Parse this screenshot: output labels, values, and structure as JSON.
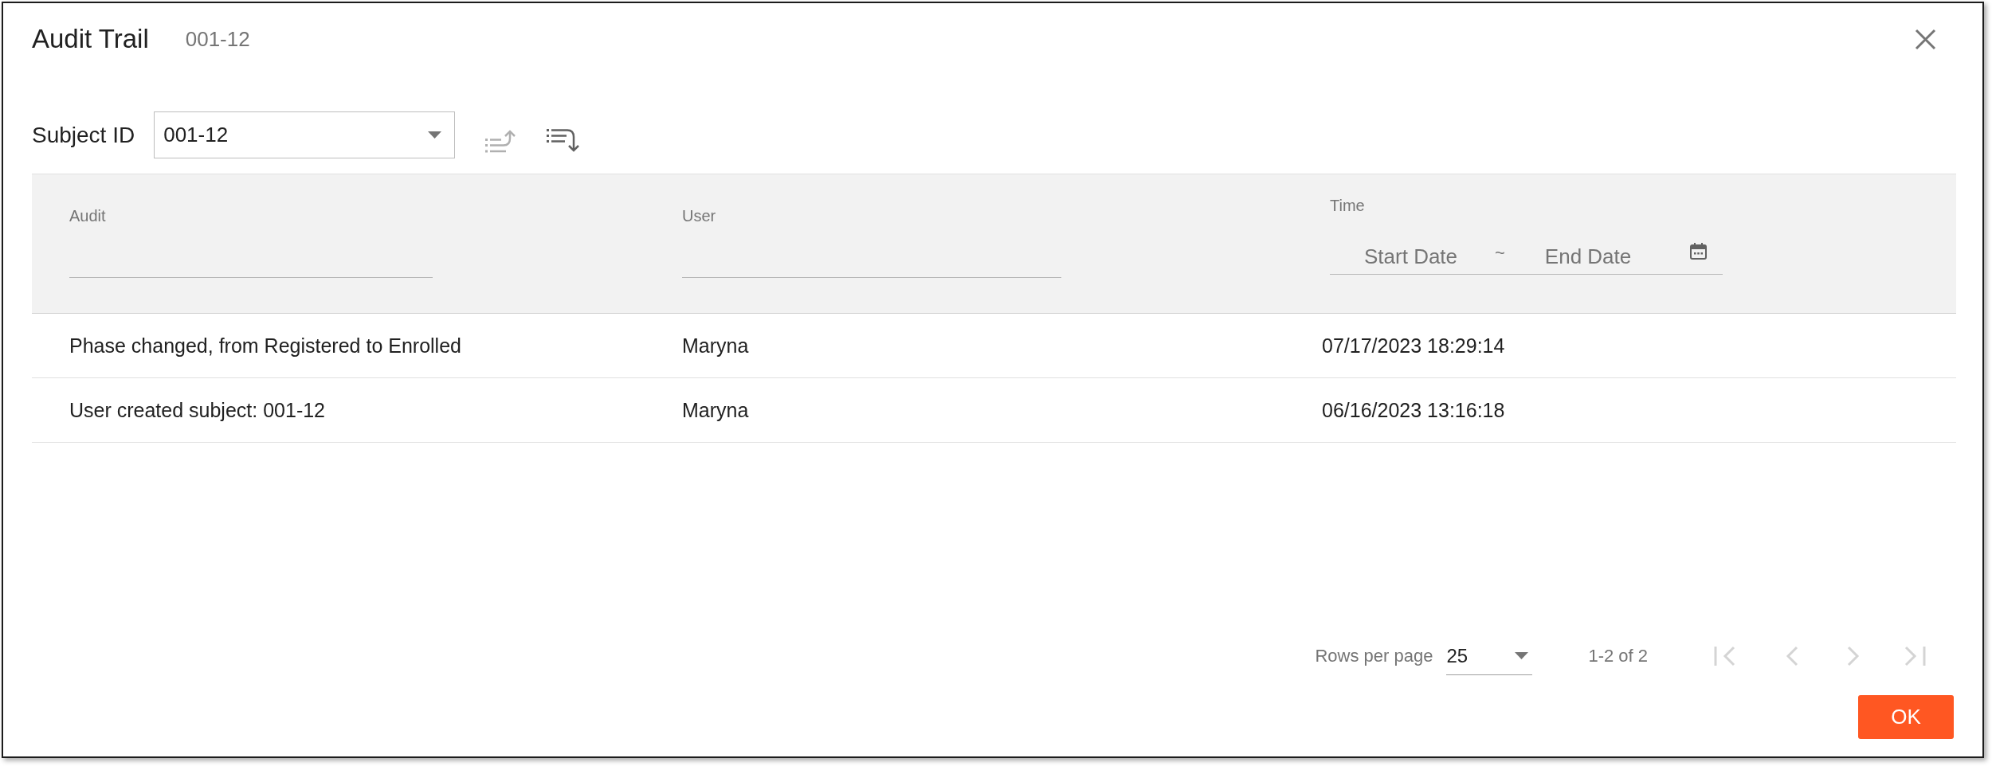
{
  "dialog": {
    "title": "Audit Trail",
    "subtitle": "001-12"
  },
  "toolbar": {
    "label": "Subject ID",
    "select_value": "001-12",
    "sort_buttons": [
      {
        "kind": "ascending",
        "disabled": true
      },
      {
        "kind": "descending",
        "disabled": false
      }
    ]
  },
  "table": {
    "columns": [
      {
        "label": "Audit",
        "kind": "text_filter"
      },
      {
        "label": "User",
        "kind": "text_filter"
      },
      {
        "label": "Time",
        "kind": "date_range",
        "start_placeholder": "Start Date",
        "separator": "~",
        "end_placeholder": "End Date"
      }
    ],
    "rows": [
      [
        "Phase changed, from Registered to Enrolled",
        "Maryna",
        "07/17/2023 18:29:14"
      ],
      [
        "User created subject: 001-12",
        "Maryna",
        "06/16/2023 13:16:18"
      ]
    ]
  },
  "pagination": {
    "rows_per_page_label": "Rows per page",
    "rows_per_page": "25",
    "range": "1-2 of 2",
    "buttons": [
      {
        "kind": "first",
        "disabled": true
      },
      {
        "kind": "previous",
        "disabled": true
      },
      {
        "kind": "next",
        "disabled": true
      },
      {
        "kind": "last",
        "disabled": true
      }
    ]
  },
  "footer_buttons": [
    "OK"
  ]
}
